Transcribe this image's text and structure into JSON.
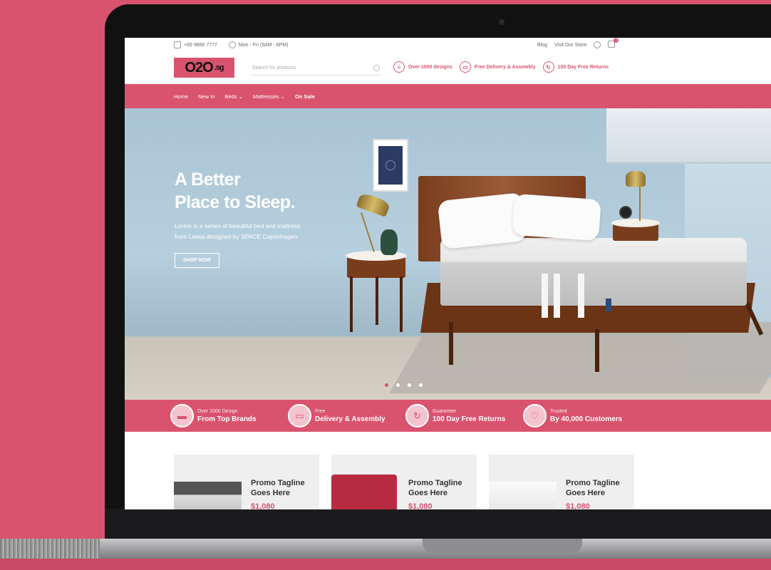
{
  "topbar": {
    "phone": "+65 9666 7777",
    "hours": "Mon - Fri (9AM - 6PM)",
    "links": [
      "Blog",
      "Visit Our Store"
    ],
    "cart_count": "0"
  },
  "header": {
    "logo": "O2O",
    "logo_suffix": ".sg",
    "search_placeholder": "Search for products",
    "features": [
      {
        "label": "Over 1000 designs",
        "icon": "list-icon"
      },
      {
        "label": "Free Delivery & Assembly",
        "icon": "truck-icon"
      },
      {
        "label": "100 Day Free Returns",
        "icon": "return-icon"
      }
    ]
  },
  "nav": {
    "items": [
      "Home",
      "New In",
      "Beds",
      "Mattresses",
      "On Sale"
    ]
  },
  "hero": {
    "title_line1": "A Better",
    "title_line2": "Place to Sleep.",
    "subtitle_line1": "Lorem is a series of beautiful bed and mattress",
    "subtitle_line2": "from Leesa designed by SPACE Copenhagen.",
    "cta": "SHOP NOW",
    "slides": 4,
    "active_slide": 1
  },
  "strip": [
    {
      "small": "Over 1000 Design",
      "big": "From Top Brands",
      "icon": "bed-icon"
    },
    {
      "small": "Free",
      "big": "Delivery & Assembly",
      "icon": "truck-icon"
    },
    {
      "small": "Guarantee",
      "big": "100 Day Free Returns",
      "icon": "refresh-icon"
    },
    {
      "small": "Trusted",
      "big": "By 40,000 Customers",
      "icon": "heart-icon"
    }
  ],
  "promos": [
    {
      "tag1": "Promo Tagline",
      "tag2": "Goes Here",
      "price": "$1,080"
    },
    {
      "tag1": "Promo Tagline",
      "tag2": "Goes Here",
      "price": "$1,080"
    },
    {
      "tag1": "Promo Tagline",
      "tag2": "Goes Here",
      "price": "$1,080"
    }
  ],
  "colors": {
    "brand": "#d9536f"
  }
}
